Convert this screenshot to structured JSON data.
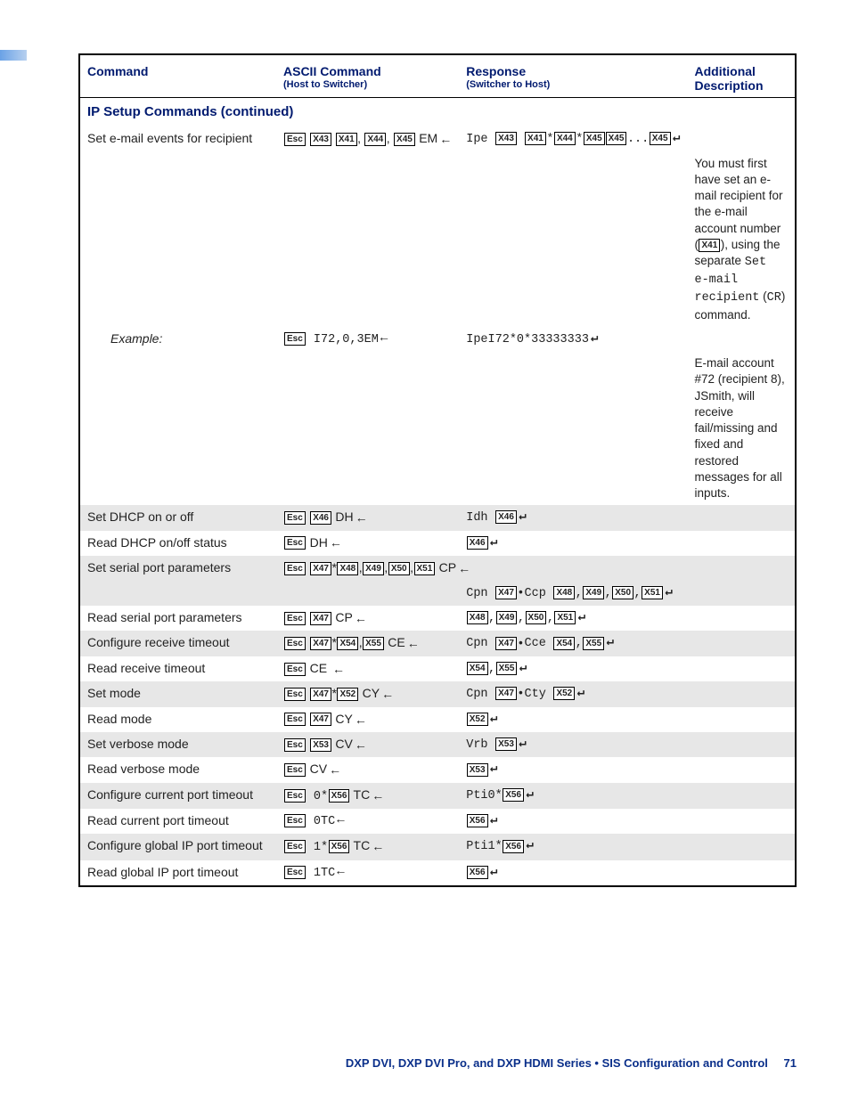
{
  "header": {
    "col1": "Command",
    "col2": "ASCII Command",
    "col2_sub": "(Host to Switcher)",
    "col3": "Response",
    "col3_sub": "(Switcher to Host)",
    "col4": "Additional Description"
  },
  "section_title": "IP Setup Commands (continued)",
  "rows": {
    "set_email": {
      "cmd": "Set e-mail events for recipient",
      "ascii": {
        "pre": "",
        "keys": [
          "Esc",
          "X43",
          "X41"
        ],
        "mid1": ",",
        "k2": [
          "X44"
        ],
        "mid2": ",",
        "k3": [
          "X45"
        ],
        "tail": " EM"
      },
      "resp": {
        "pre": "Ipe ",
        "k": [
          "X43",
          "X41"
        ],
        "s1": "*",
        "k2": [
          "X44"
        ],
        "s2": "*",
        "k3": [
          "X45",
          "X45"
        ],
        "dots": "...",
        "k4": [
          "X45"
        ]
      },
      "desc1": "You must first have set an e-mail recipient for the e-mail account number (",
      "desc_x": "X41",
      "desc2": "), using the separate ",
      "desc_code1": "Set e-mail recipient",
      "desc3": " (",
      "desc_code2": "CR",
      "desc4": ") command."
    },
    "example": {
      "cmd": "Example:",
      "ascii_text": "I72,0,3EM",
      "resp_text": "IpeI72*0*33333333",
      "desc": "E-mail account #72 (recipient 8), JSmith, will receive fail/missing and fixed and restored messages for all inputs."
    },
    "set_dhcp": {
      "cmd": "Set DHCP on or off",
      "ascii": {
        "keys": [
          "Esc",
          "X46"
        ],
        "tail": " DH"
      },
      "resp": {
        "pre": "Idh ",
        "k": [
          "X46"
        ]
      }
    },
    "read_dhcp": {
      "cmd": "Read DHCP on/off status",
      "ascii": {
        "keys": [
          "Esc"
        ],
        "tail": " DH"
      },
      "resp": {
        "k": [
          "X46"
        ]
      }
    },
    "set_serial": {
      "cmd": "Set serial port parameters",
      "ascii": {
        "keys": [
          "Esc",
          "X47"
        ],
        "s": "*",
        "k2": [
          "X48"
        ],
        "c1": ",",
        "k3": [
          "X49"
        ],
        "c2": ",",
        "k4": [
          "X50"
        ],
        "c3": ",",
        "k5": [
          "X51"
        ],
        "tail": " CP"
      },
      "resp": {
        "pre": "Cpn ",
        "k": [
          "X47"
        ],
        "mid": "•Ccp ",
        "k2": [
          "X48"
        ],
        "c1": ",",
        "k3": [
          "X49"
        ],
        "c2": ",",
        "k4": [
          "X50"
        ],
        "c3": ",",
        "k5": [
          "X51"
        ]
      }
    },
    "read_serial": {
      "cmd": "Read serial port parameters",
      "ascii": {
        "keys": [
          "Esc",
          "X47"
        ],
        "tail": " CP"
      },
      "resp": {
        "k": [
          "X48"
        ],
        "c1": ",",
        "k2": [
          "X49"
        ],
        "c2": ",",
        "k3": [
          "X50"
        ],
        "c3": ",",
        "k4": [
          "X51"
        ]
      }
    },
    "conf_recv": {
      "cmd": "Configure receive timeout",
      "ascii": {
        "keys": [
          "Esc",
          "X47"
        ],
        "s": "*",
        "k2": [
          "X54"
        ],
        "c1": ",",
        "k3": [
          "X55"
        ],
        "tail": " CE"
      },
      "resp": {
        "pre": "Cpn ",
        "k": [
          "X47"
        ],
        "mid": "•Cce ",
        "k2": [
          "X54"
        ],
        "c1": ",",
        "k3": [
          "X55"
        ]
      }
    },
    "read_recv": {
      "cmd": "Read receive timeout",
      "ascii": {
        "keys": [
          "Esc"
        ],
        "tail": " CE"
      },
      "resp": {
        "k": [
          "X54"
        ],
        "c1": ",",
        "k2": [
          "X55"
        ]
      }
    },
    "set_mode": {
      "cmd": "Set mode",
      "ascii": {
        "keys": [
          "Esc",
          "X47"
        ],
        "s": "*",
        "k2": [
          "X52"
        ],
        "tail": " CY"
      },
      "resp": {
        "pre": "Cpn ",
        "k": [
          "X47"
        ],
        "mid": "•Cty ",
        "k2": [
          "X52"
        ]
      }
    },
    "read_mode": {
      "cmd": "Read mode",
      "ascii": {
        "keys": [
          "Esc",
          "X47"
        ],
        "tail": " CY"
      },
      "resp": {
        "k": [
          "X52"
        ]
      }
    },
    "set_verbose": {
      "cmd": "Set verbose mode",
      "ascii": {
        "keys": [
          "Esc",
          "X53"
        ],
        "tail": " CV"
      },
      "resp": {
        "pre": "Vrb ",
        "k": [
          "X53"
        ]
      }
    },
    "read_verbose": {
      "cmd": "Read verbose mode",
      "ascii": {
        "keys": [
          "Esc"
        ],
        "tail": " CV"
      },
      "resp": {
        "k": [
          "X53"
        ]
      }
    },
    "conf_cur_port": {
      "cmd": "Configure current port timeout",
      "ascii": {
        "keys": [
          "Esc"
        ],
        "pre2": " 0*",
        "k2": [
          "X56"
        ],
        "tail": " TC"
      },
      "resp": {
        "pre": "Pti0*",
        "k": [
          "X56"
        ]
      }
    },
    "read_cur_port": {
      "cmd": "Read current port timeout",
      "ascii": {
        "keys": [
          "Esc"
        ],
        "tail": " 0TC"
      },
      "resp": {
        "k": [
          "X56"
        ]
      }
    },
    "conf_glob_port": {
      "cmd": "Configure global IP port timeout",
      "ascii": {
        "keys": [
          "Esc"
        ],
        "pre2": " 1*",
        "k2": [
          "X56"
        ],
        "tail": " TC"
      },
      "resp": {
        "pre": "Pti1*",
        "k": [
          "X56"
        ]
      }
    },
    "read_glob_port": {
      "cmd": "Read global IP port timeout",
      "ascii": {
        "keys": [
          "Esc"
        ],
        "tail": " 1TC"
      },
      "resp": {
        "k": [
          "X56"
        ]
      }
    }
  },
  "footer": {
    "title": "DXP DVI, DXP DVI Pro, and DXP HDMI Series • SIS Configuration and Control",
    "page": "71"
  },
  "keys": {
    "Esc": "Esc",
    "X41": "X41",
    "X43": "X43",
    "X44": "X44",
    "X45": "X45",
    "X46": "X46",
    "X47": "X47",
    "X48": "X48",
    "X49": "X49",
    "X50": "X50",
    "X51": "X51",
    "X52": "X52",
    "X53": "X53",
    "X54": "X54",
    "X55": "X55",
    "X56": "X56"
  }
}
